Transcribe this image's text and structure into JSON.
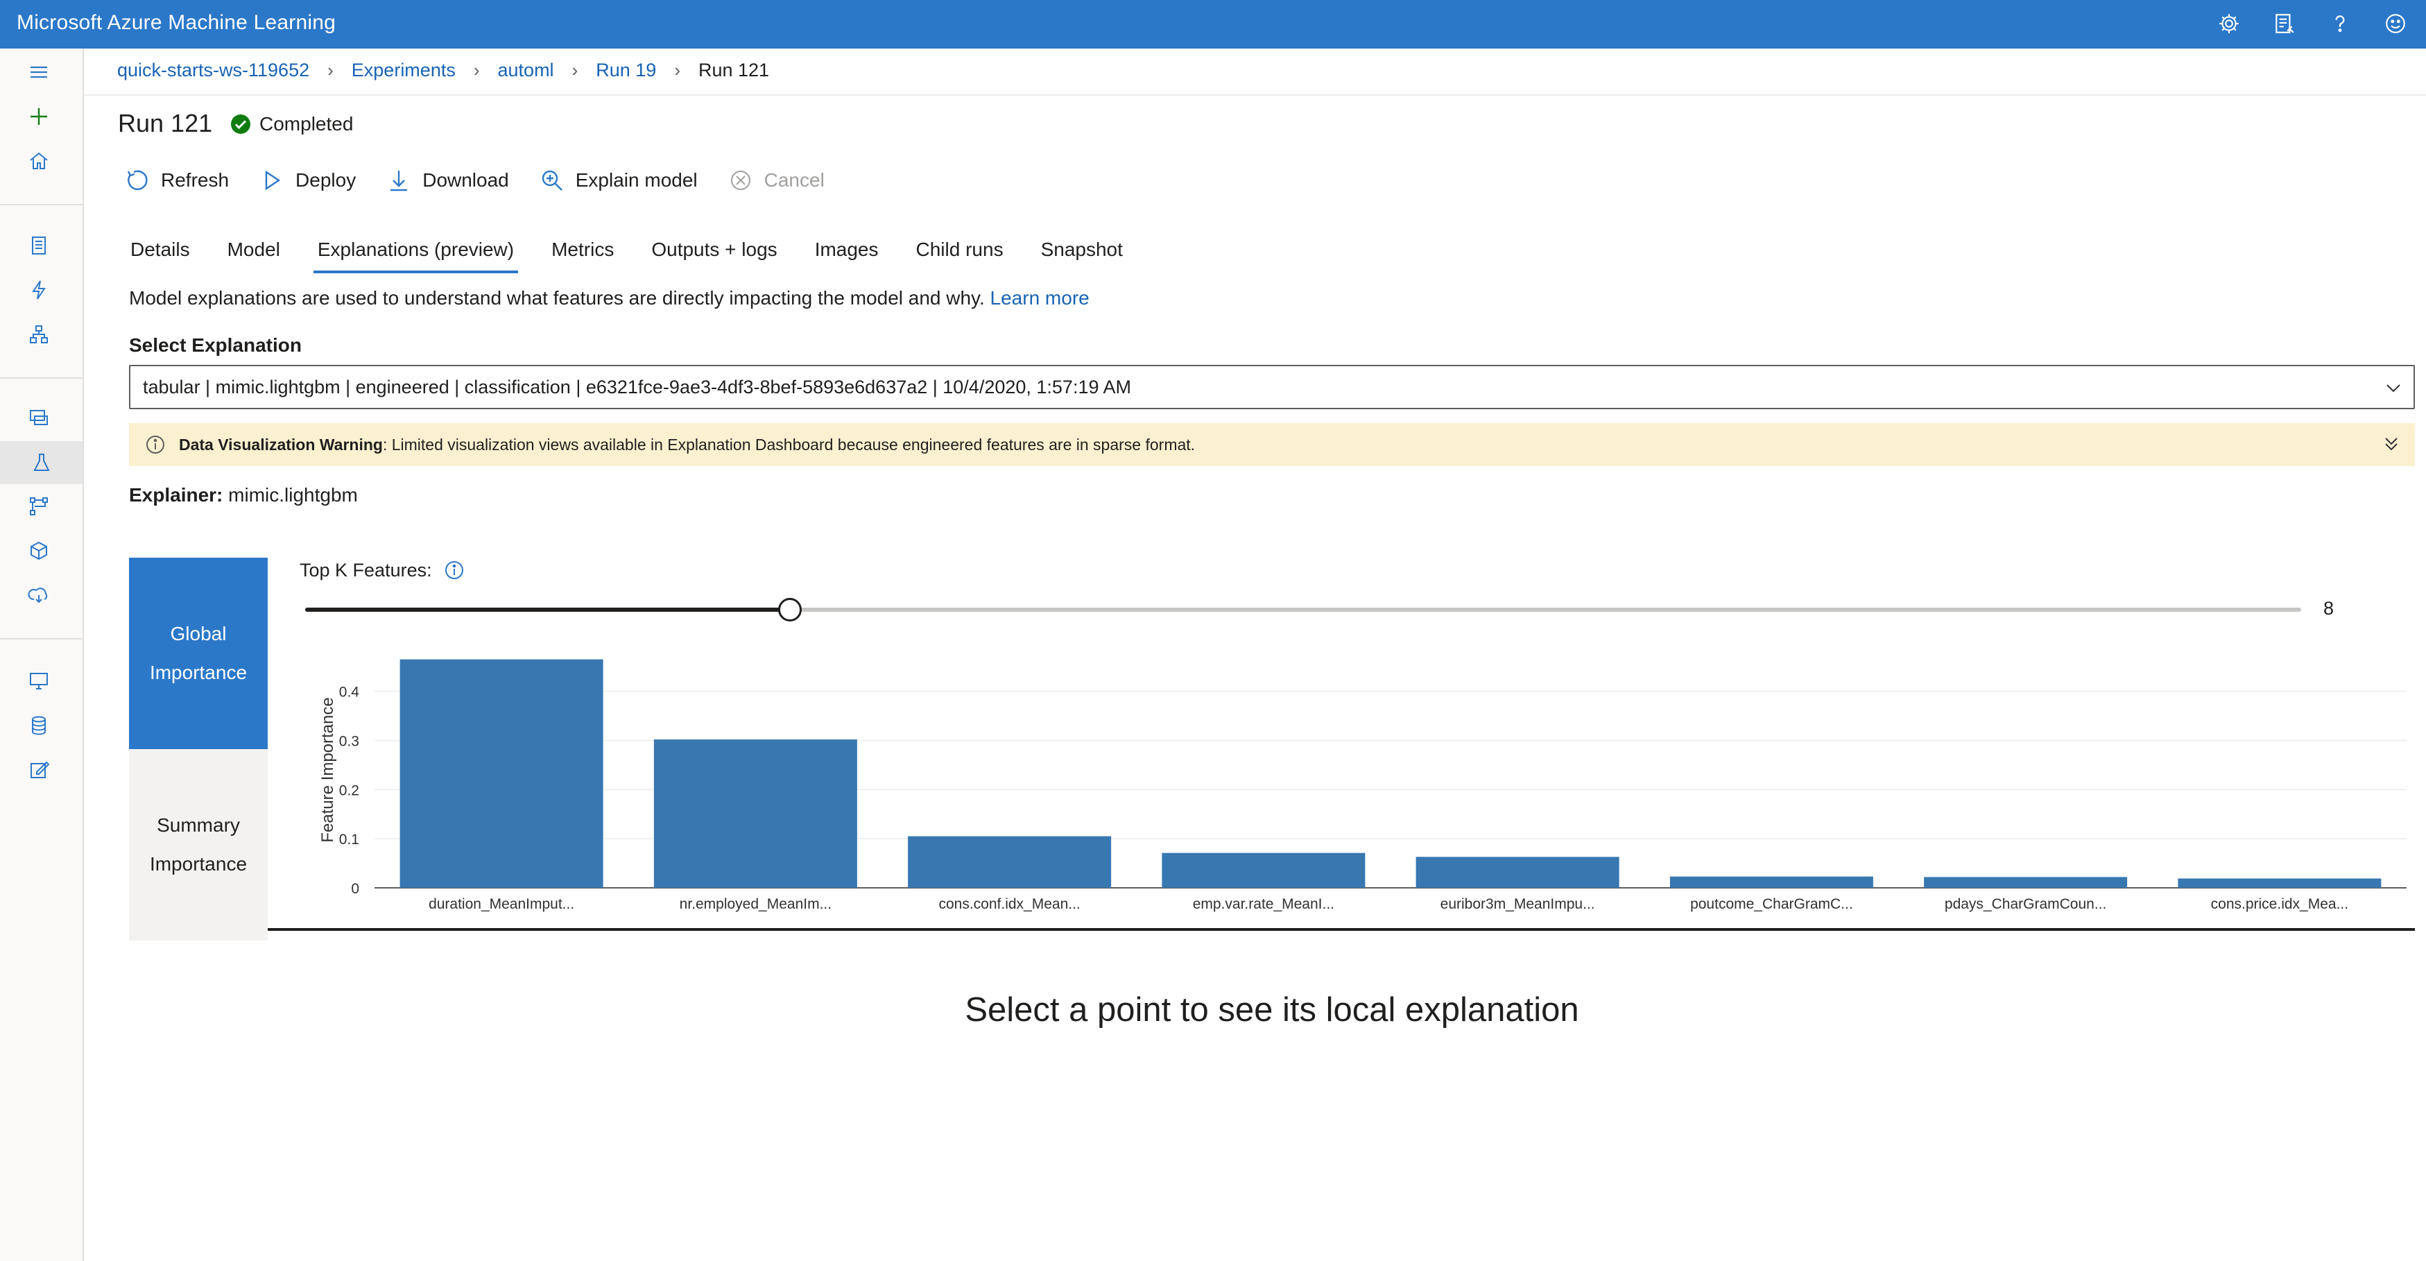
{
  "app": {
    "title": "Microsoft Azure Machine Learning"
  },
  "topbar_icons": [
    "gear-icon",
    "feedback-list-icon",
    "help-icon",
    "smiley-icon"
  ],
  "breadcrumb": {
    "items": [
      "quick-starts-ws-119652",
      "Experiments",
      "automl",
      "Run 19",
      "Run 121"
    ]
  },
  "run": {
    "title": "Run 121",
    "status": "Completed",
    "status_color": "#107c10"
  },
  "toolbar": {
    "refresh": "Refresh",
    "deploy": "Deploy",
    "download": "Download",
    "explain": "Explain model",
    "cancel": "Cancel"
  },
  "tabs": [
    "Details",
    "Model",
    "Explanations (preview)",
    "Metrics",
    "Outputs + logs",
    "Images",
    "Child runs",
    "Snapshot"
  ],
  "active_tab": "Explanations (preview)",
  "explanations": {
    "description": "Model explanations are used to understand what features are directly impacting the model and why.",
    "learn_more": "Learn more",
    "select_label": "Select Explanation",
    "selected": "tabular | mimic.lightgbm | engineered | classification | e6321fce-9ae3-4df3-8bef-5893e6d637a2 | 10/4/2020, 1:57:19 AM",
    "warning_title": "Data Visualization Warning",
    "warning_text": ": Limited visualization views available in Explanation Dashboard because engineered features are in sparse format.",
    "explainer_label": "Explainer:",
    "explainer_value": "mimic.lightgbm"
  },
  "side_tabs": {
    "global_line1": "Global",
    "global_line2": "Importance",
    "summary_line1": "Summary",
    "summary_line2": "Importance"
  },
  "topk": {
    "label": "Top K Features:",
    "value": "8",
    "fraction": 0.243
  },
  "chart_data": {
    "type": "bar",
    "ylabel": "Feature Importance",
    "xlabel": "",
    "ylim": [
      0,
      0.48
    ],
    "yticks": [
      0,
      0.1,
      0.2,
      0.3,
      0.4
    ],
    "ytick_labels": [
      "0",
      "0.1",
      "0.2",
      "0.3",
      "0.4"
    ],
    "grid": true,
    "bar_color": "#3877b0",
    "categories": [
      "duration_MeanImput...",
      "nr.employed_MeanIm...",
      "cons.conf.idx_Mean...",
      "emp.var.rate_MeanI...",
      "euribor3m_MeanImpu...",
      "poutcome_CharGramC...",
      "pdays_CharGramCoun...",
      "cons.price.idx_Mea..."
    ],
    "values": [
      0.465,
      0.302,
      0.105,
      0.071,
      0.063,
      0.023,
      0.022,
      0.019
    ]
  },
  "local_message": "Select a point to see its local explanation",
  "colors": {
    "accent": "#2b78c9",
    "link": "#1863b5",
    "warning_bg": "#fbf1d0"
  }
}
